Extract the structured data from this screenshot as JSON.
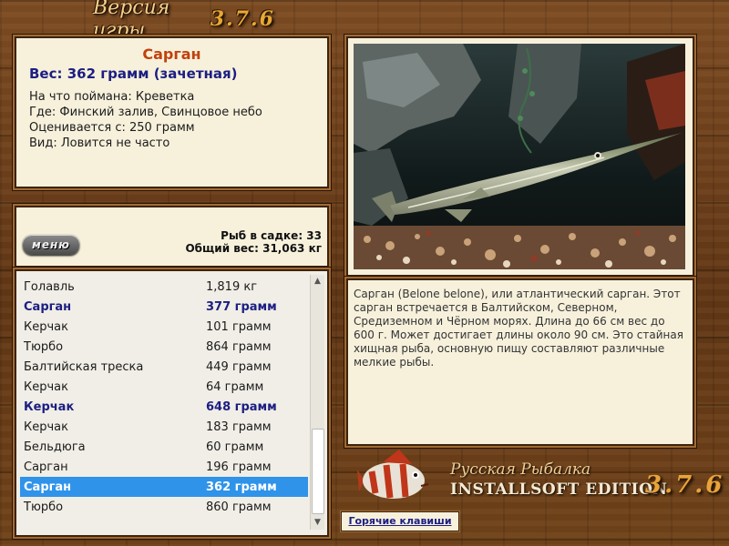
{
  "header": {
    "version_label": "Версия игры",
    "version_number": "3.7.6"
  },
  "fish_info": {
    "name": "Сарган",
    "weight": "Вес: 362 грамм (зачетная)",
    "lines": [
      "На что поймана: Креветка",
      "Где: Финский залив, Свинцовое небо",
      "Оценивается с: 250 грамм",
      "Вид: Ловится не часто"
    ]
  },
  "summary": {
    "menu_label": "меню",
    "fish_in_net": "Рыб в садке: 33",
    "total_weight": "Общий вес: 31,063 кг"
  },
  "list": {
    "rows": [
      {
        "name": "Голавль",
        "weight": "1,819 кг",
        "style": "normal"
      },
      {
        "name": "Сарган",
        "weight": "377 грамм",
        "style": "bold"
      },
      {
        "name": "Керчак",
        "weight": "101 грамм",
        "style": "normal"
      },
      {
        "name": "Тюрбо",
        "weight": "864 грамм",
        "style": "normal"
      },
      {
        "name": "Балтийская треска",
        "weight": "449 грамм",
        "style": "normal"
      },
      {
        "name": "Керчак",
        "weight": "64 грамм",
        "style": "normal"
      },
      {
        "name": "Керчак",
        "weight": "648 грамм",
        "style": "bold"
      },
      {
        "name": "Керчак",
        "weight": "183 грамм",
        "style": "normal"
      },
      {
        "name": "Бельдюга",
        "weight": "60 грамм",
        "style": "normal"
      },
      {
        "name": "Сарган",
        "weight": "196 грамм",
        "style": "normal"
      },
      {
        "name": "Сарган",
        "weight": "362 грамм",
        "style": "selected"
      },
      {
        "name": "Тюрбо",
        "weight": "860 грамм",
        "style": "normal"
      }
    ]
  },
  "description": "Сарган (Belone belone), или атлантический сарган. Этот сарган встречается в Балтийском, Северном, Средиземном и Чёрном морях. Длина до 66 см вес до 600 г. Может достигает длины около 90 см. Это стайная хищная рыба, основную пищу составляют различные мелкие рыбы.",
  "logo": {
    "line1": "Русская Рыбалка",
    "line2": "INSTALLSOFT EDITION",
    "version": "3.7.6"
  },
  "hotkeys_label": "Горячие клавиши",
  "colors": {
    "title": "#c2410c",
    "accent_blue": "#1c1e82",
    "selection": "#2f93ea",
    "parchment": "#f7f1dc"
  }
}
